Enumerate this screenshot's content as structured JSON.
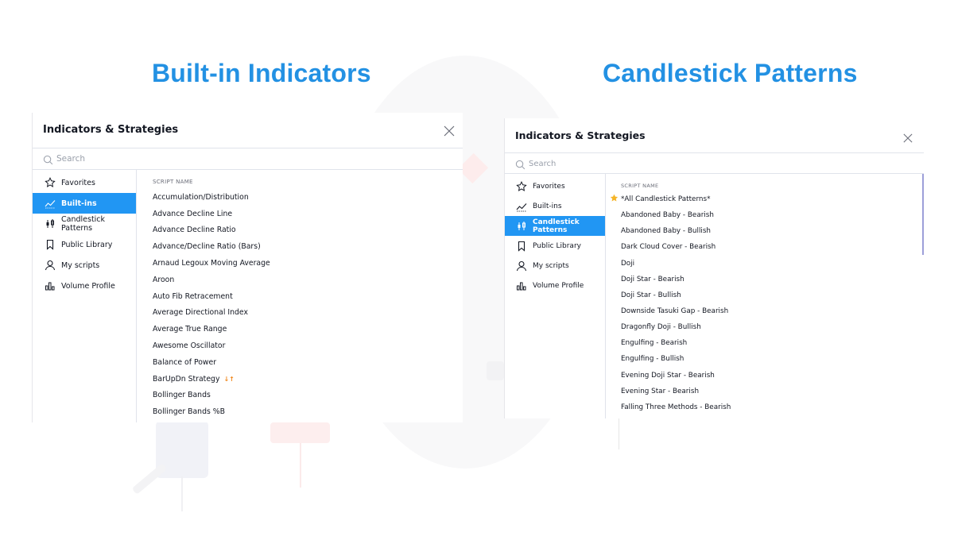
{
  "headings": {
    "left": "Built-in Indicators",
    "right": "Candlestick Patterns"
  },
  "accent_color": "#2196f3",
  "heading_color": "#2391e3",
  "dialogs": [
    {
      "title": "Indicators & Strategies",
      "search": {
        "placeholder": "Search",
        "value": ""
      },
      "sidebar": [
        {
          "label": "Favorites",
          "icon": "star-icon",
          "active": false
        },
        {
          "label": "Built-ins",
          "icon": "chart-line-icon",
          "active": true
        },
        {
          "label": "Candlestick Patterns",
          "icon": "candlestick-icon",
          "active": false
        },
        {
          "label": "Public Library",
          "icon": "bookmark-icon",
          "active": false
        },
        {
          "label": "My scripts",
          "icon": "user-icon",
          "active": false
        },
        {
          "label": "Volume Profile",
          "icon": "volume-profile-icon",
          "active": false
        }
      ],
      "column_header": "SCRIPT NAME",
      "rows": [
        {
          "name": "Accumulation/Distribution"
        },
        {
          "name": "Advance Decline Line"
        },
        {
          "name": "Advance Decline Ratio"
        },
        {
          "name": "Advance/Decline Ratio (Bars)"
        },
        {
          "name": "Arnaud Legoux Moving Average"
        },
        {
          "name": "Aroon"
        },
        {
          "name": "Auto Fib Retracement"
        },
        {
          "name": "Average Directional Index"
        },
        {
          "name": "Average True Range"
        },
        {
          "name": "Awesome Oscillator"
        },
        {
          "name": "Balance of Power"
        },
        {
          "name": "BarUpDn Strategy",
          "badge": "↓↑"
        },
        {
          "name": "Bollinger Bands"
        },
        {
          "name": "Bollinger Bands %B"
        }
      ]
    },
    {
      "title": "Indicators & Strategies",
      "search": {
        "placeholder": "Search",
        "value": ""
      },
      "sidebar": [
        {
          "label": "Favorites",
          "icon": "star-icon",
          "active": false
        },
        {
          "label": "Built-ins",
          "icon": "chart-line-icon",
          "active": false
        },
        {
          "label": "Candlestick Patterns",
          "icon": "candlestick-icon",
          "active": true
        },
        {
          "label": "Public Library",
          "icon": "bookmark-icon",
          "active": false
        },
        {
          "label": "My scripts",
          "icon": "user-icon",
          "active": false
        },
        {
          "label": "Volume Profile",
          "icon": "volume-profile-icon",
          "active": false
        }
      ],
      "column_header": "SCRIPT NAME",
      "rows": [
        {
          "name": "*All Candlestick Patterns*",
          "starred": true
        },
        {
          "name": "Abandoned Baby - Bearish"
        },
        {
          "name": "Abandoned Baby - Bullish"
        },
        {
          "name": "Dark Cloud Cover - Bearish"
        },
        {
          "name": "Doji"
        },
        {
          "name": "Doji Star - Bearish"
        },
        {
          "name": "Doji Star - Bullish"
        },
        {
          "name": "Downside Tasuki Gap - Bearish"
        },
        {
          "name": "Dragonfly Doji - Bullish"
        },
        {
          "name": "Engulfing - Bearish"
        },
        {
          "name": "Engulfing - Bullish"
        },
        {
          "name": "Evening Doji Star - Bearish"
        },
        {
          "name": "Evening Star - Bearish"
        },
        {
          "name": "Falling Three Methods - Bearish"
        }
      ]
    }
  ]
}
